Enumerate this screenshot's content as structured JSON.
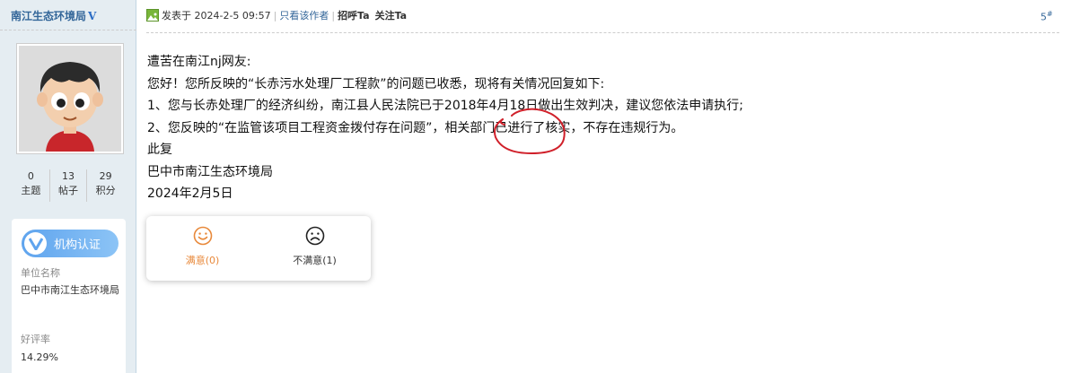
{
  "author": {
    "name": "南江生态环境局",
    "verified_mark": "V",
    "stats": [
      {
        "value": "0",
        "label": "主题"
      },
      {
        "value": "13",
        "label": "帖子"
      },
      {
        "value": "29",
        "label": "积分"
      }
    ],
    "certification": {
      "badge_label": "机构认证",
      "unit_label": "单位名称",
      "unit_value": "巴中市南江生态环境局",
      "rating_label": "好评率",
      "rating_value": "14.29%"
    }
  },
  "post": {
    "posted_at": "发表于 2024-2-5 09:57",
    "only_author": "只看该作者",
    "greet": "招呼Ta",
    "follow": "关注Ta",
    "floor": "5",
    "floor_mark": "#",
    "body": [
      "遭苦在南江nj网友:",
      "您好！您所反映的“长赤污水处理厂工程款”的问题已收悉，现将有关情况回复如下:",
      "1、您与长赤处理厂的经济纠纷，南江县人民法院已于2018年4月18日做出生效判决，建议您依法申请执行;",
      "2、您反映的“在监管该项目工程资金拨付存在问题”，相关部门已进行了核实，不存在违规行为。",
      "此复",
      "巴中市南江生态环境局",
      "2024年2月5日"
    ]
  },
  "rating": {
    "satisfied": "满意(0)",
    "unsatisfied": "不满意(1)"
  },
  "colors": {
    "sidebar_bg": "#e5edf2",
    "link_blue": "#336699",
    "badge_blue": "#5fa4ee",
    "satisfied_orange": "#e8893b",
    "annotation_red": "#d0202a"
  }
}
